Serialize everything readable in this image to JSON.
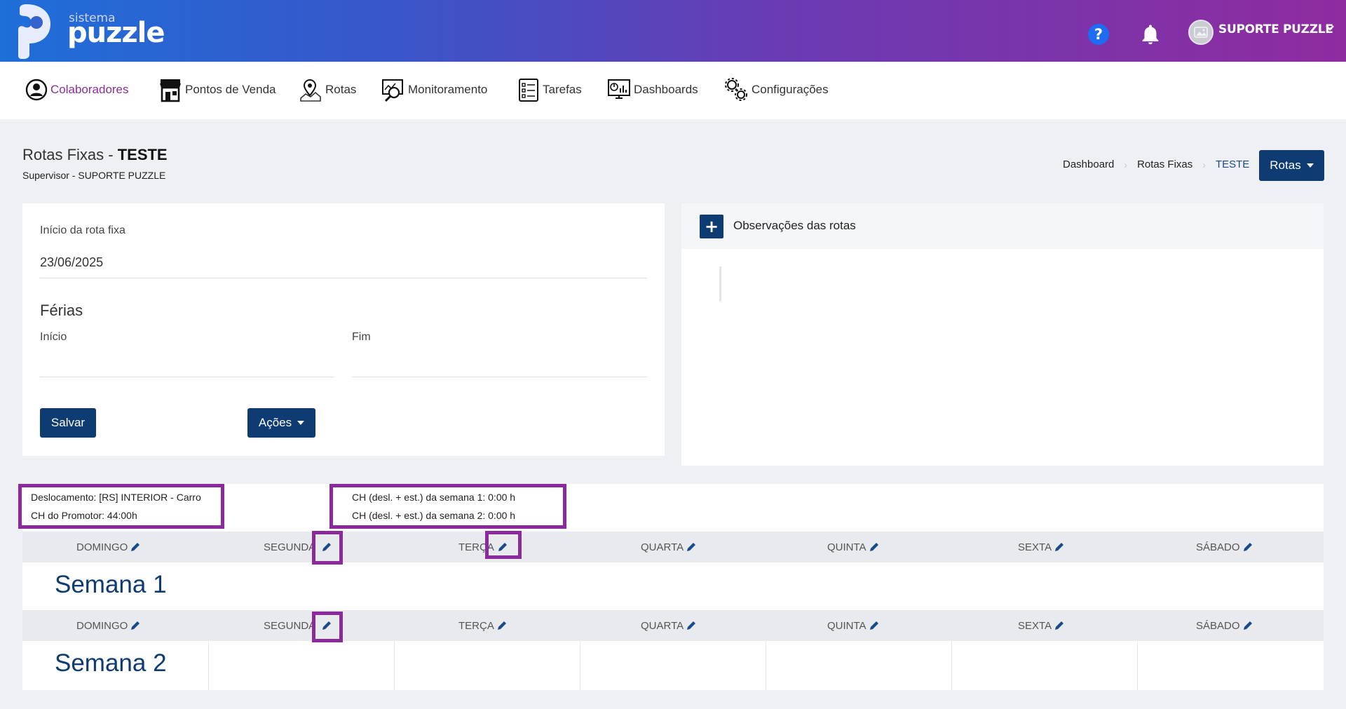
{
  "header": {
    "logo_small": "sistema",
    "logo_big": "puzzle",
    "help_glyph": "?",
    "user_name": "SUPORTE PUZZLE",
    "icons": [
      "help-icon",
      "bell-icon",
      "avatar",
      "chevron-down-icon"
    ]
  },
  "nav": {
    "items": [
      {
        "label": "Colaboradores",
        "icon": "user-circle-icon",
        "active": true
      },
      {
        "label": "Pontos de Venda",
        "icon": "store-icon"
      },
      {
        "label": "Rotas",
        "icon": "map-pin-icon"
      },
      {
        "label": "Monitoramento",
        "icon": "monitoring-icon"
      },
      {
        "label": "Tarefas",
        "icon": "checklist-icon"
      },
      {
        "label": "Dashboards",
        "icon": "dashboard-icon"
      },
      {
        "label": "Configurações",
        "icon": "gears-icon"
      }
    ]
  },
  "page": {
    "title_prefix": "Rotas Fixas - ",
    "title_strong": "TESTE",
    "subtitle": "Supervisor - SUPORTE PUZZLE",
    "breadcrumb": [
      "Dashboard",
      "Rotas Fixas",
      "TESTE"
    ],
    "rotas_button": "Rotas"
  },
  "form": {
    "inicio_label": "Início da rota fixa",
    "inicio_value": "23/06/2025",
    "ferias_title": "Férias",
    "ferias_inicio_label": "Início",
    "ferias_fim_label": "Fim",
    "salvar_button": "Salvar",
    "acoes_button": "Ações"
  },
  "observacoes": {
    "plus_glyph": "+",
    "title": "Observações das rotas"
  },
  "info": {
    "deslocamento": "Deslocamento: [RS] INTERIOR - Carro",
    "ch_promotor": "CH do Promotor: 44:00h",
    "ch_semana1": "CH (desl. + est.) da semana 1: 0:00 h",
    "ch_semana2": "CH (desl. + est.) da semana 2: 0:00 h"
  },
  "days": [
    "DOMINGO",
    "SEGUNDA",
    "TERÇA",
    "QUARTA",
    "QUINTA",
    "SEXTA",
    "SÁBADO"
  ],
  "weeks": [
    "Semana 1",
    "Semana 2"
  ],
  "colors": {
    "accent": "#8b2e9c",
    "primary_button": "#0d3b72",
    "highlight_box": "#8a2a9c"
  }
}
